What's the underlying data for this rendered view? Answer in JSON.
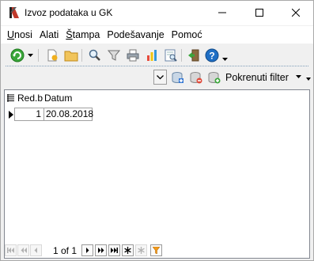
{
  "window": {
    "title": "Izvoz podataka u GK"
  },
  "menu": {
    "items": [
      {
        "label": "Unosi",
        "mnemonic": "U",
        "rest": "nosi"
      },
      {
        "label": "Alati",
        "mnemonic": "",
        "rest": "Alati"
      },
      {
        "label": "Štampa",
        "mnemonic": "Š",
        "rest": "tampa"
      },
      {
        "label": "Podešavanje",
        "mnemonic": "",
        "rest": "Podešavanje"
      },
      {
        "label": "Pomoć",
        "mnemonic": "",
        "rest": "Pomoć"
      }
    ]
  },
  "toolbar": {
    "icons": [
      "refresh-icon",
      "dropdown-caret-icon",
      "new-document-icon",
      "open-folder-icon",
      "search-icon",
      "filter-icon",
      "print-icon",
      "chart-icon",
      "print-preview-icon",
      "exit-icon",
      "help-icon",
      "dropdown-caret-icon"
    ]
  },
  "filterbar": {
    "run_filter_label": "Pokrenuti filter"
  },
  "grid": {
    "columns": [
      "Red.b",
      "Datum"
    ],
    "rows": [
      {
        "redb": "1",
        "datum": "20.08.2018"
      }
    ]
  },
  "navigator": {
    "position_text": "1 of 1"
  },
  "colors": {
    "accent_green": "#3aa63a",
    "help_blue": "#1f6fc5",
    "filter_orange": "#f29a1c"
  }
}
